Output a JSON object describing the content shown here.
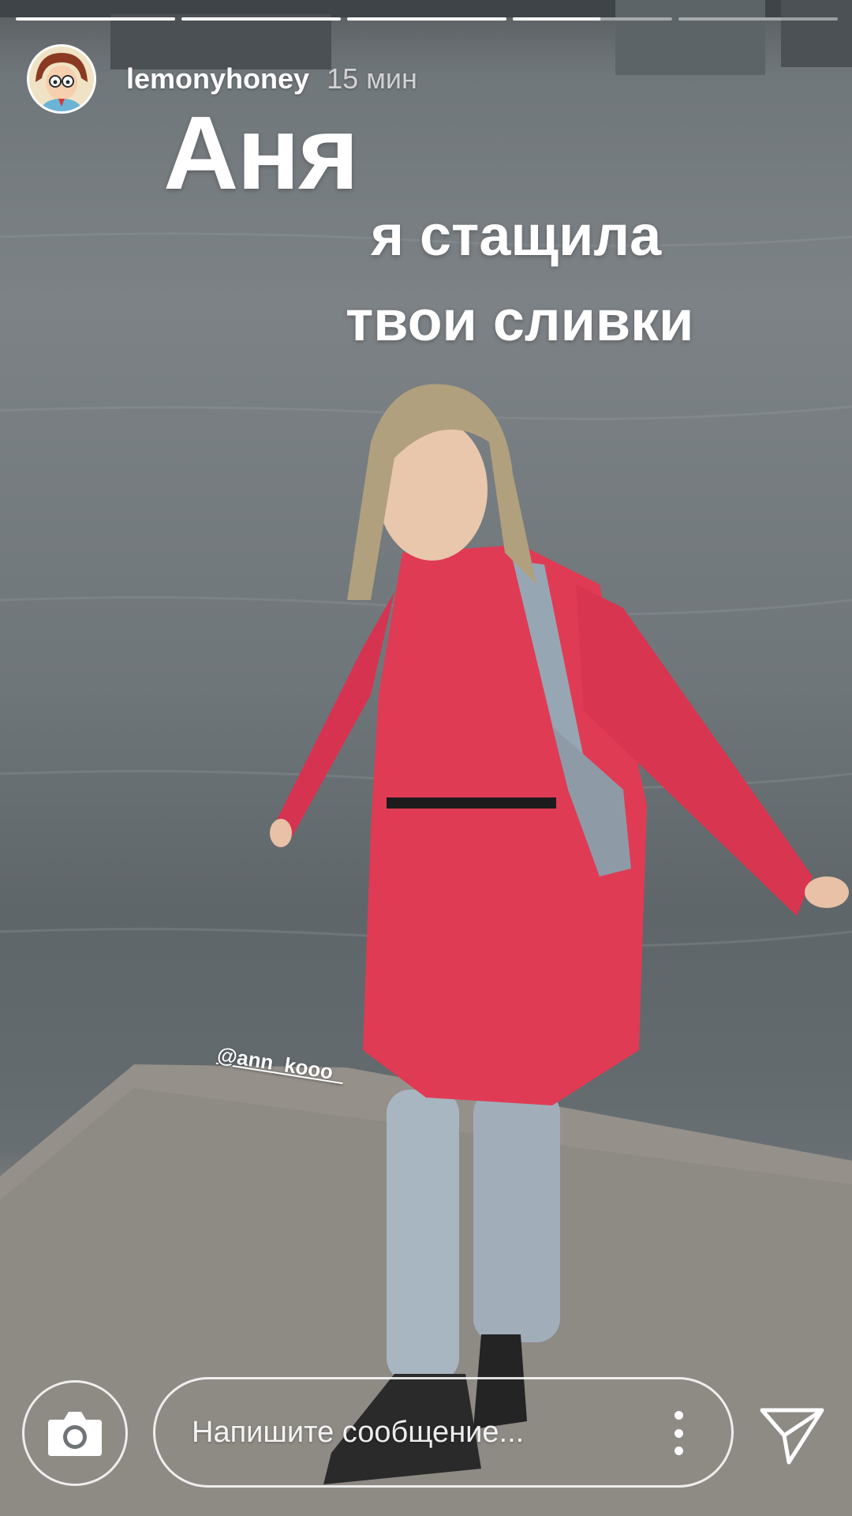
{
  "progress": {
    "segments": [
      1,
      1,
      1,
      0.55,
      0
    ]
  },
  "header": {
    "username": "lemonyhoney",
    "timestamp": "15 мин",
    "avatar_icon": "cartoon-character-avatar"
  },
  "story": {
    "title": "Аня",
    "line1": "я стащила",
    "line2": "твои сливки",
    "mention": "@ann_kooo_"
  },
  "reply_bar": {
    "camera_icon": "camera-icon",
    "placeholder": "Напишите сообщение...",
    "more_icon": "more-vertical-icon",
    "send_icon": "send-icon"
  }
}
